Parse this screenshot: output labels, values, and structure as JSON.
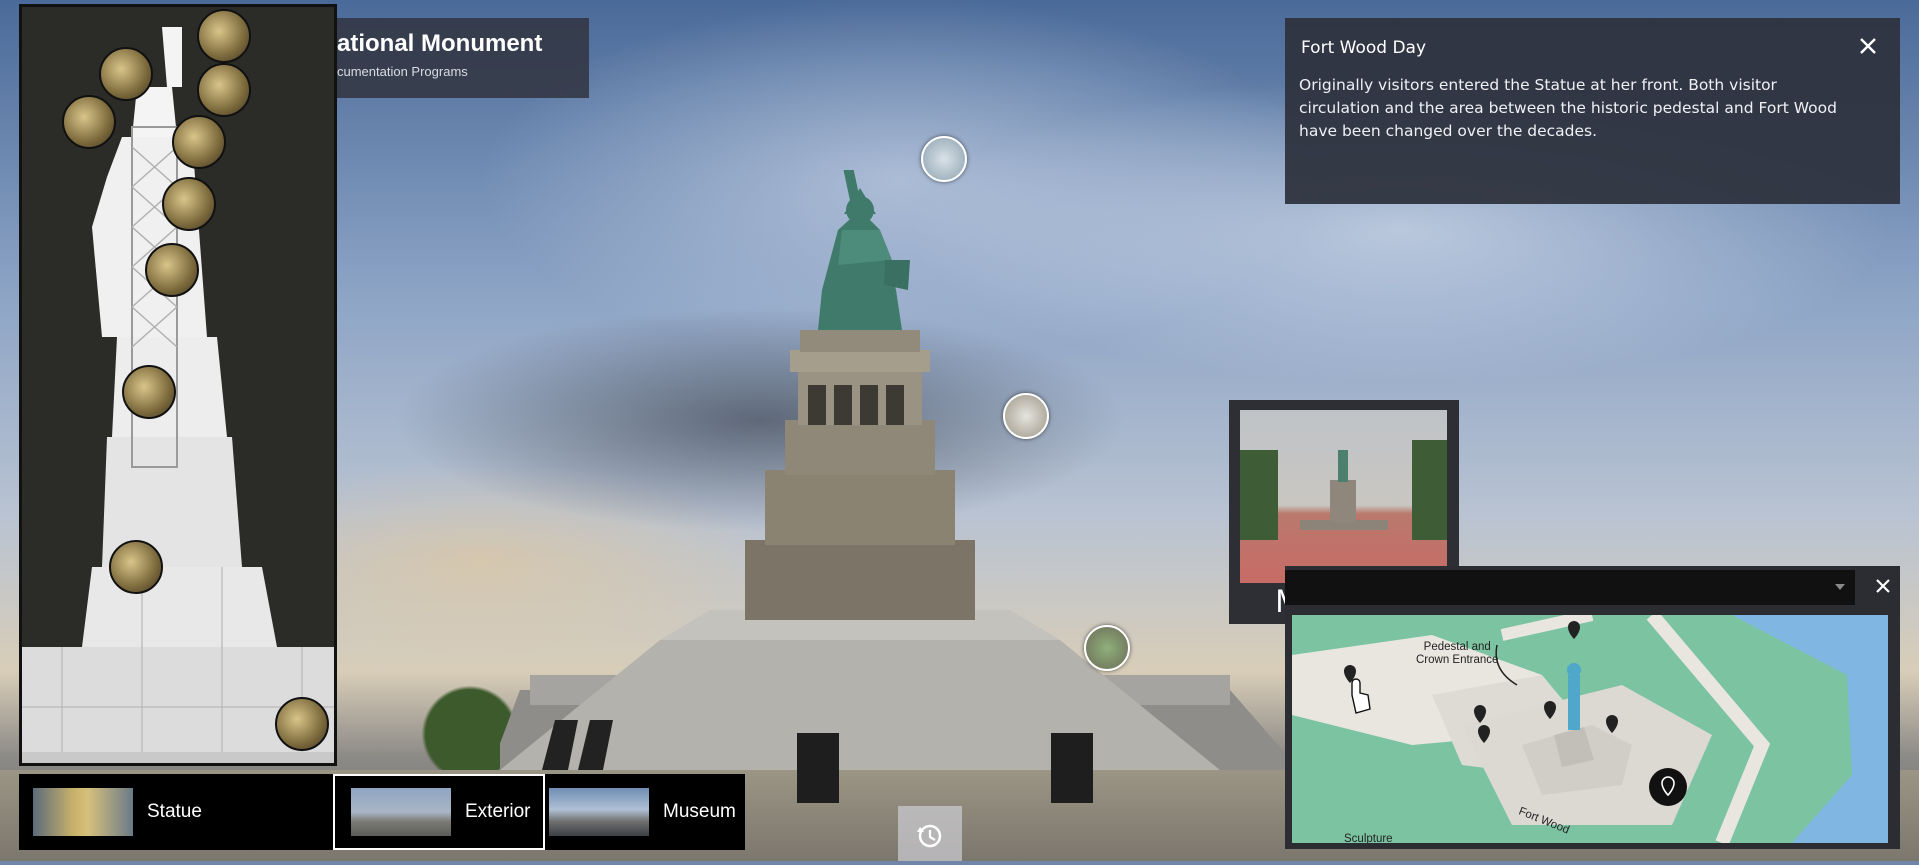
{
  "title": {
    "main": "ational Monument",
    "subtitle": "cumentation Programs"
  },
  "info_panel": {
    "title": "Fort Wood Day",
    "text": "Originally visitors entered the Statue at her front. Both visitor circulation and the area between the historic pedestal and Fort Wood have been changed over the decades.",
    "close_icon": "close-icon"
  },
  "scene_tabs": [
    {
      "label": "Statue",
      "active": false
    },
    {
      "label": "Exterior",
      "active": true
    },
    {
      "label": "Museum",
      "active": false
    }
  ],
  "history_button": {
    "icon": "history-icon"
  },
  "preview": {
    "caption": "Main Mall"
  },
  "map": {
    "selected_value": "",
    "labels": {
      "pedestal": "Pedestal and\nCrown Entrance",
      "fort_wood": "Fort Wood",
      "sculpture": "Sculpture"
    },
    "close_icon": "close-icon"
  },
  "colors": {
    "panel_bg": "#2e323e",
    "map_green": "#7cc4a1",
    "map_water": "#7fb6e2",
    "statue_green": "#3f7a6a"
  }
}
